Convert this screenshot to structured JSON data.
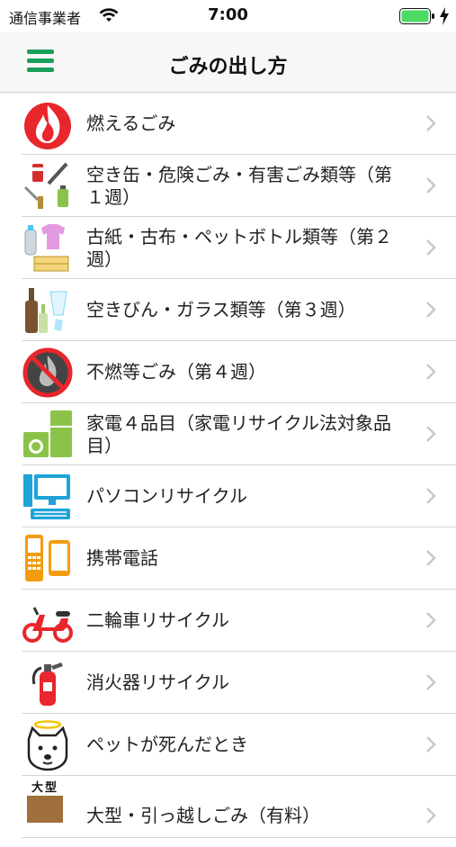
{
  "status_bar": {
    "carrier": "通信事業者",
    "time": "7:00",
    "battery_color": "#4cd964"
  },
  "nav": {
    "title": "ごみの出し方",
    "accent_color": "#1a9e5a"
  },
  "items": [
    {
      "label": "燃えるごみ",
      "icon": "fire-icon"
    },
    {
      "label": "空き缶・危険ごみ・有害ごみ類等（第１週）",
      "icon": "cans-hazard-icon"
    },
    {
      "label": "古紙・古布・ペットボトル類等（第２週）",
      "icon": "paper-cloth-bottle-icon"
    },
    {
      "label": "空きびん・ガラス類等（第３週）",
      "icon": "bottles-glass-icon"
    },
    {
      "label": "不燃等ごみ（第４週）",
      "icon": "non-burnable-icon"
    },
    {
      "label": "家電４品目（家電リサイクル法対象品目）",
      "icon": "appliances-icon"
    },
    {
      "label": "パソコンリサイクル",
      "icon": "computer-icon"
    },
    {
      "label": "携帯電話",
      "icon": "mobile-phone-icon"
    },
    {
      "label": "二輪車リサイクル",
      "icon": "scooter-icon"
    },
    {
      "label": "消火器リサイクル",
      "icon": "fire-extinguisher-icon"
    },
    {
      "label": "ペットが死んだとき",
      "icon": "pet-dog-icon"
    },
    {
      "label": "大型・引っ越しごみ（有料）",
      "icon": "large-items-icon",
      "icon_text": "大型"
    }
  ]
}
